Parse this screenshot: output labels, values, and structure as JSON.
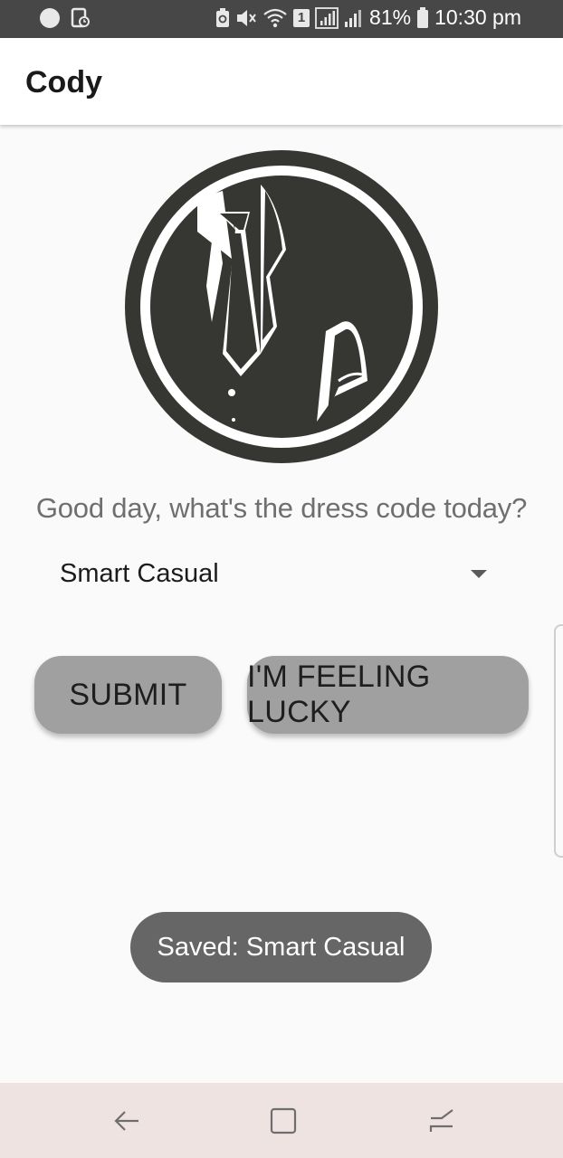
{
  "status_bar": {
    "battery_percent": "81%",
    "time": "10:30 pm",
    "sim_badge": "1",
    "icons": [
      "circle-icon",
      "screenshot-icon",
      "battery-saver-icon",
      "mute-icon",
      "wifi-icon",
      "sim-icon",
      "signal-icon",
      "signal-icon",
      "battery-icon"
    ]
  },
  "app_bar": {
    "title": "Cody"
  },
  "logo": {
    "icon": "suit-logo-icon",
    "color": "#363632"
  },
  "main": {
    "prompt": "Good day, what's the dress code today?",
    "dress_code_select": {
      "selected": "Smart Casual"
    },
    "submit_label": "SUBMIT",
    "lucky_label": "I'M FEELING LUCKY"
  },
  "toast": {
    "message": "Saved: Smart Casual"
  },
  "nav_bar": {
    "icons": [
      "back-icon",
      "home-icon",
      "recents-icon"
    ]
  },
  "colors": {
    "status_bar": "#474747",
    "button": "#a0a0a0",
    "toast": "#666666",
    "nav_bar": "#efe3e2"
  }
}
